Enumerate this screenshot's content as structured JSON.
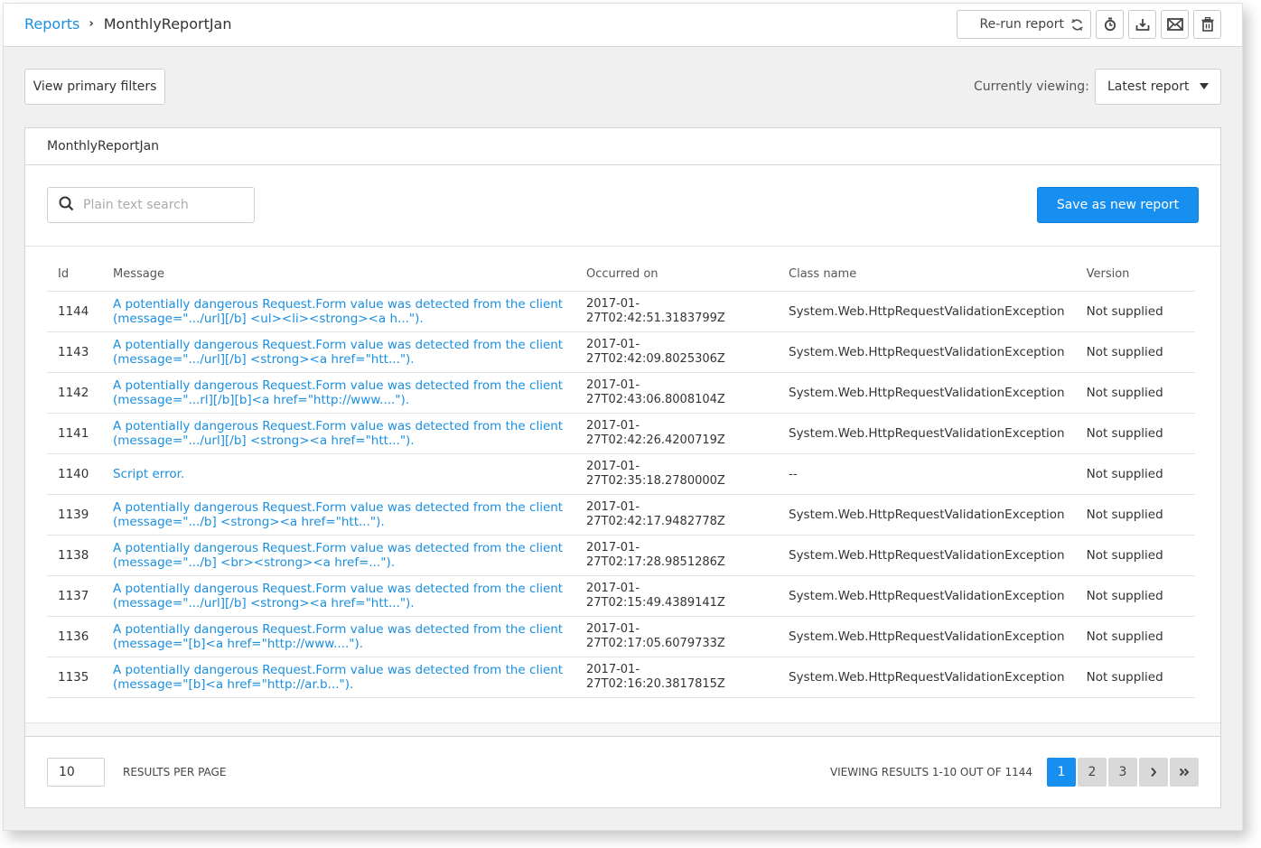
{
  "header": {
    "breadcrumb_root": "Reports",
    "breadcrumb_current": "MonthlyReportJan",
    "rerun_label": "Re-run report",
    "icons": [
      "refresh-icon",
      "timer-icon",
      "download-icon",
      "email-icon",
      "trash-icon"
    ]
  },
  "filters": {
    "view_primary_filters": "View primary filters",
    "currently_viewing_label": "Currently viewing:",
    "currently_viewing_value": "Latest report"
  },
  "panel": {
    "title": "MonthlyReportJan",
    "search_placeholder": "Plain text search",
    "search_value": "",
    "save_label": "Save as new report"
  },
  "table": {
    "columns": [
      "Id",
      "Message",
      "Occurred on",
      "Class name",
      "Version"
    ],
    "rows": [
      {
        "id": "1144",
        "message_line1": "A potentially dangerous Request.Form value was detected from the client",
        "message_line2": "(message=\".../url][/b] <ul><li><strong><a h...\").",
        "date_line1": "2017-01-",
        "date_line2": "27T02:42:51.3183799Z",
        "class": "System.Web.HttpRequestValidationException",
        "version": "Not supplied"
      },
      {
        "id": "1143",
        "message_line1": "A potentially dangerous Request.Form value was detected from the client",
        "message_line2": "(message=\".../url][/b] <strong><a href=\"htt...\").",
        "date_line1": "2017-01-",
        "date_line2": "27T02:42:09.8025306Z",
        "class": "System.Web.HttpRequestValidationException",
        "version": "Not supplied"
      },
      {
        "id": "1142",
        "message_line1": "A potentially dangerous Request.Form value was detected from the client",
        "message_line2": "(message=\"...rl][/b][b]<a href=\"http://www....\").",
        "date_line1": "2017-01-",
        "date_line2": "27T02:43:06.8008104Z",
        "class": "System.Web.HttpRequestValidationException",
        "version": "Not supplied"
      },
      {
        "id": "1141",
        "message_line1": "A potentially dangerous Request.Form value was detected from the client",
        "message_line2": "(message=\".../url][/b] <strong><a href=\"htt...\").",
        "date_line1": "2017-01-",
        "date_line2": "27T02:42:26.4200719Z",
        "class": "System.Web.HttpRequestValidationException",
        "version": "Not supplied"
      },
      {
        "id": "1140",
        "message_line1": "Script error.",
        "message_line2": "",
        "date_line1": "2017-01-",
        "date_line2": "27T02:35:18.2780000Z",
        "class": "--",
        "version": "Not supplied"
      },
      {
        "id": "1139",
        "message_line1": "A potentially dangerous Request.Form value was detected from the client",
        "message_line2": "(message=\".../b] <strong><a href=\"htt...\").",
        "date_line1": "2017-01-",
        "date_line2": "27T02:42:17.9482778Z",
        "class": "System.Web.HttpRequestValidationException",
        "version": "Not supplied"
      },
      {
        "id": "1138",
        "message_line1": "A potentially dangerous Request.Form value was detected from the client",
        "message_line2": "(message=\".../b] <br><strong><a href=...\").",
        "date_line1": "2017-01-",
        "date_line2": "27T02:17:28.9851286Z",
        "class": "System.Web.HttpRequestValidationException",
        "version": "Not supplied"
      },
      {
        "id": "1137",
        "message_line1": "A potentially dangerous Request.Form value was detected from the client",
        "message_line2": "(message=\".../url][/b] <strong><a href=\"htt...\").",
        "date_line1": "2017-01-",
        "date_line2": "27T02:15:49.4389141Z",
        "class": "System.Web.HttpRequestValidationException",
        "version": "Not supplied"
      },
      {
        "id": "1136",
        "message_line1": "A potentially dangerous Request.Form value was detected from the client",
        "message_line2": "(message=\"[b]<a href=\"http://www....\").",
        "date_line1": "2017-01-",
        "date_line2": "27T02:17:05.6079733Z",
        "class": "System.Web.HttpRequestValidationException",
        "version": "Not supplied"
      },
      {
        "id": "1135",
        "message_line1": "A potentially dangerous Request.Form value was detected from the client",
        "message_line2": "(message=\"[b]<a href=\"http://ar.b...\").",
        "date_line1": "2017-01-",
        "date_line2": "27T02:16:20.3817815Z",
        "class": "System.Web.HttpRequestValidationException",
        "version": "Not supplied"
      }
    ]
  },
  "pagination": {
    "per_page_value": "10",
    "per_page_label": "RESULTS PER PAGE",
    "viewing_results": "VIEWING RESULTS 1-10 OUT OF 1144",
    "pages": [
      "1",
      "2",
      "3"
    ],
    "current_page": "1",
    "next_label": "›",
    "last_label": "»"
  },
  "colors": {
    "accent": "#168ff0",
    "link": "#1a8fe0",
    "page_bg": "#f0f0f0"
  }
}
